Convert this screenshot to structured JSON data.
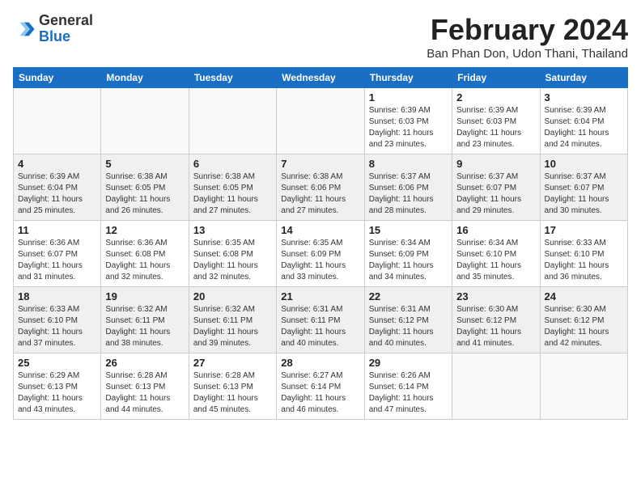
{
  "header": {
    "logo_general": "General",
    "logo_blue": "Blue",
    "month_year": "February 2024",
    "location": "Ban Phan Don, Udon Thani, Thailand"
  },
  "days_of_week": [
    "Sunday",
    "Monday",
    "Tuesday",
    "Wednesday",
    "Thursday",
    "Friday",
    "Saturday"
  ],
  "weeks": [
    [
      {
        "day": "",
        "info": ""
      },
      {
        "day": "",
        "info": ""
      },
      {
        "day": "",
        "info": ""
      },
      {
        "day": "",
        "info": ""
      },
      {
        "day": "1",
        "info": "Sunrise: 6:39 AM\nSunset: 6:03 PM\nDaylight: 11 hours\nand 23 minutes."
      },
      {
        "day": "2",
        "info": "Sunrise: 6:39 AM\nSunset: 6:03 PM\nDaylight: 11 hours\nand 23 minutes."
      },
      {
        "day": "3",
        "info": "Sunrise: 6:39 AM\nSunset: 6:04 PM\nDaylight: 11 hours\nand 24 minutes."
      }
    ],
    [
      {
        "day": "4",
        "info": "Sunrise: 6:39 AM\nSunset: 6:04 PM\nDaylight: 11 hours\nand 25 minutes."
      },
      {
        "day": "5",
        "info": "Sunrise: 6:38 AM\nSunset: 6:05 PM\nDaylight: 11 hours\nand 26 minutes."
      },
      {
        "day": "6",
        "info": "Sunrise: 6:38 AM\nSunset: 6:05 PM\nDaylight: 11 hours\nand 27 minutes."
      },
      {
        "day": "7",
        "info": "Sunrise: 6:38 AM\nSunset: 6:06 PM\nDaylight: 11 hours\nand 27 minutes."
      },
      {
        "day": "8",
        "info": "Sunrise: 6:37 AM\nSunset: 6:06 PM\nDaylight: 11 hours\nand 28 minutes."
      },
      {
        "day": "9",
        "info": "Sunrise: 6:37 AM\nSunset: 6:07 PM\nDaylight: 11 hours\nand 29 minutes."
      },
      {
        "day": "10",
        "info": "Sunrise: 6:37 AM\nSunset: 6:07 PM\nDaylight: 11 hours\nand 30 minutes."
      }
    ],
    [
      {
        "day": "11",
        "info": "Sunrise: 6:36 AM\nSunset: 6:07 PM\nDaylight: 11 hours\nand 31 minutes."
      },
      {
        "day": "12",
        "info": "Sunrise: 6:36 AM\nSunset: 6:08 PM\nDaylight: 11 hours\nand 32 minutes."
      },
      {
        "day": "13",
        "info": "Sunrise: 6:35 AM\nSunset: 6:08 PM\nDaylight: 11 hours\nand 32 minutes."
      },
      {
        "day": "14",
        "info": "Sunrise: 6:35 AM\nSunset: 6:09 PM\nDaylight: 11 hours\nand 33 minutes."
      },
      {
        "day": "15",
        "info": "Sunrise: 6:34 AM\nSunset: 6:09 PM\nDaylight: 11 hours\nand 34 minutes."
      },
      {
        "day": "16",
        "info": "Sunrise: 6:34 AM\nSunset: 6:10 PM\nDaylight: 11 hours\nand 35 minutes."
      },
      {
        "day": "17",
        "info": "Sunrise: 6:33 AM\nSunset: 6:10 PM\nDaylight: 11 hours\nand 36 minutes."
      }
    ],
    [
      {
        "day": "18",
        "info": "Sunrise: 6:33 AM\nSunset: 6:10 PM\nDaylight: 11 hours\nand 37 minutes."
      },
      {
        "day": "19",
        "info": "Sunrise: 6:32 AM\nSunset: 6:11 PM\nDaylight: 11 hours\nand 38 minutes."
      },
      {
        "day": "20",
        "info": "Sunrise: 6:32 AM\nSunset: 6:11 PM\nDaylight: 11 hours\nand 39 minutes."
      },
      {
        "day": "21",
        "info": "Sunrise: 6:31 AM\nSunset: 6:11 PM\nDaylight: 11 hours\nand 40 minutes."
      },
      {
        "day": "22",
        "info": "Sunrise: 6:31 AM\nSunset: 6:12 PM\nDaylight: 11 hours\nand 40 minutes."
      },
      {
        "day": "23",
        "info": "Sunrise: 6:30 AM\nSunset: 6:12 PM\nDaylight: 11 hours\nand 41 minutes."
      },
      {
        "day": "24",
        "info": "Sunrise: 6:30 AM\nSunset: 6:12 PM\nDaylight: 11 hours\nand 42 minutes."
      }
    ],
    [
      {
        "day": "25",
        "info": "Sunrise: 6:29 AM\nSunset: 6:13 PM\nDaylight: 11 hours\nand 43 minutes."
      },
      {
        "day": "26",
        "info": "Sunrise: 6:28 AM\nSunset: 6:13 PM\nDaylight: 11 hours\nand 44 minutes."
      },
      {
        "day": "27",
        "info": "Sunrise: 6:28 AM\nSunset: 6:13 PM\nDaylight: 11 hours\nand 45 minutes."
      },
      {
        "day": "28",
        "info": "Sunrise: 6:27 AM\nSunset: 6:14 PM\nDaylight: 11 hours\nand 46 minutes."
      },
      {
        "day": "29",
        "info": "Sunrise: 6:26 AM\nSunset: 6:14 PM\nDaylight: 11 hours\nand 47 minutes."
      },
      {
        "day": "",
        "info": ""
      },
      {
        "day": "",
        "info": ""
      }
    ]
  ]
}
